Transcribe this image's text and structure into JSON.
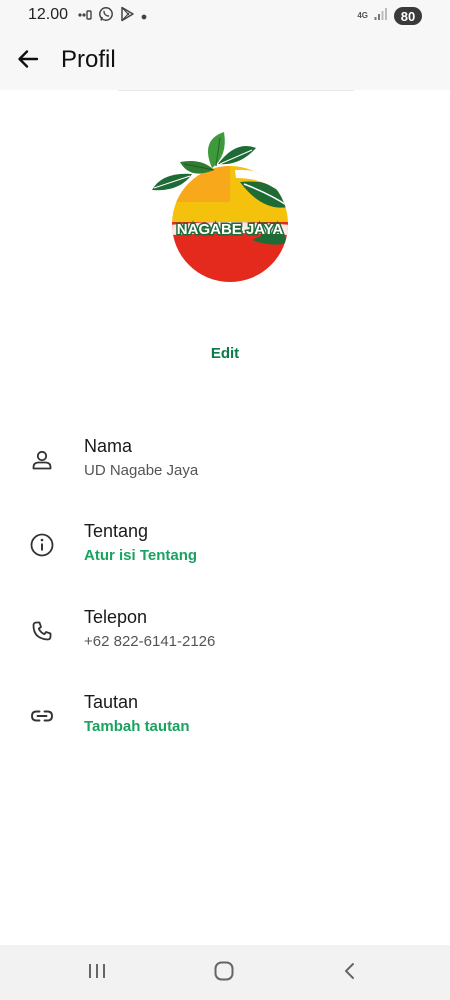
{
  "status_bar": {
    "time": "12.00",
    "network_label": "4G",
    "battery": "80",
    "icons": [
      "signal-dots-icon",
      "whatsapp-icon",
      "play-store-icon",
      "dot-icon",
      "cellular-signal-icon"
    ]
  },
  "header": {
    "title": "Profil",
    "back_icon": "arrow-left-icon"
  },
  "profile": {
    "logo_text": "NAGABE JAYA",
    "edit_label": "Edit"
  },
  "info": {
    "name": {
      "label": "Nama",
      "value": "UD Nagabe Jaya",
      "icon": "person-icon"
    },
    "about": {
      "label": "Tentang",
      "value": "Atur isi Tentang",
      "icon": "info-icon"
    },
    "phone": {
      "label": "Telepon",
      "value": "+62 822-6141-2126",
      "icon": "phone-icon"
    },
    "link": {
      "label": "Tautan",
      "value": "Tambah tautan",
      "icon": "link-icon"
    }
  },
  "colors": {
    "accent_green": "#1aa260",
    "edit_green": "#0a7a4a",
    "logo_yellow": "#f4c20d",
    "logo_red": "#e42a1d",
    "logo_leaf": "#1f6b35"
  },
  "nav_bar": {
    "icons": [
      "recent-apps-icon",
      "home-icon",
      "back-nav-icon"
    ]
  }
}
